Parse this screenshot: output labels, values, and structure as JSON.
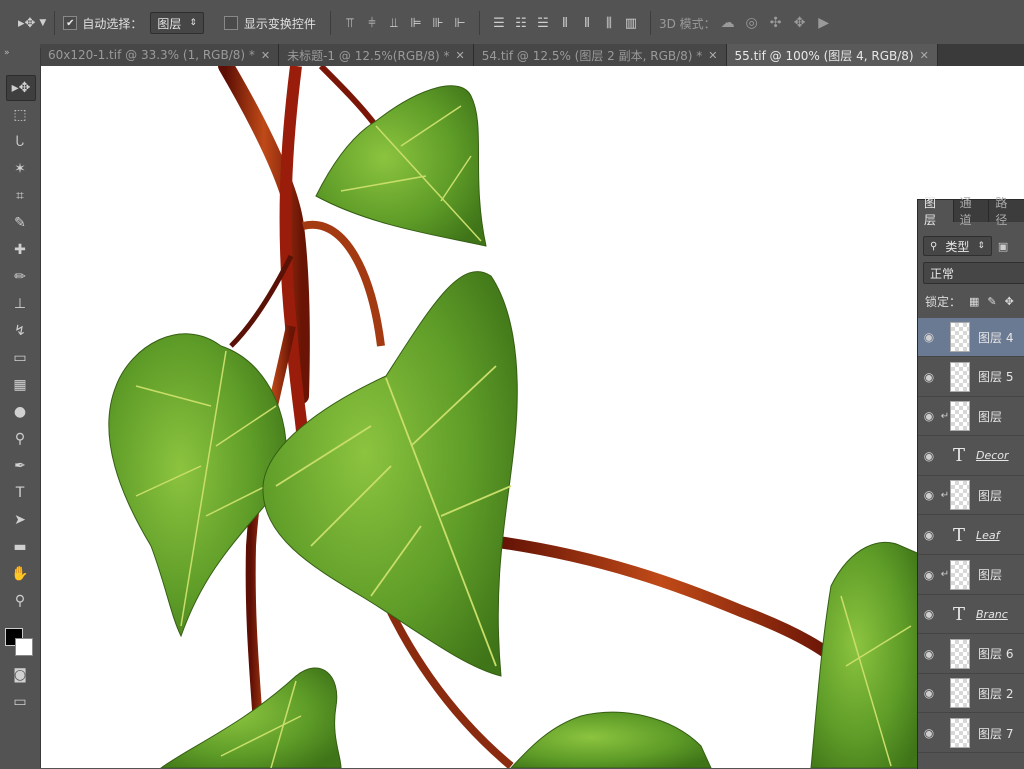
{
  "options_bar": {
    "auto_select_label": "自动选择：",
    "auto_select_value": "图层",
    "show_transform_label": "显示变换控件",
    "mode_3d_label": "3D 模式："
  },
  "document_tabs": [
    {
      "label": "60x120-1.tif @ 33.3% (1, RGB/8) *",
      "active": false
    },
    {
      "label": "未标题-1 @ 12.5%(RGB/8) *",
      "active": false
    },
    {
      "label": "54.tif @ 12.5% (图层 2 副本, RGB/8) *",
      "active": false
    },
    {
      "label": "55.tif @ 100% (图层 4, RGB/8)",
      "active": true
    }
  ],
  "tools": [
    {
      "name": "move-tool",
      "glyph": "▸✥"
    },
    {
      "name": "marquee-tool",
      "glyph": "⬚"
    },
    {
      "name": "lasso-tool",
      "glyph": "ᘂ"
    },
    {
      "name": "magic-wand-tool",
      "glyph": "✶"
    },
    {
      "name": "crop-tool",
      "glyph": "⌗"
    },
    {
      "name": "eyedropper-tool",
      "glyph": "✎"
    },
    {
      "name": "healing-brush-tool",
      "glyph": "✚"
    },
    {
      "name": "brush-tool",
      "glyph": "✏"
    },
    {
      "name": "clone-stamp-tool",
      "glyph": "⊥"
    },
    {
      "name": "history-brush-tool",
      "glyph": "↯"
    },
    {
      "name": "eraser-tool",
      "glyph": "▭"
    },
    {
      "name": "gradient-tool",
      "glyph": "▦"
    },
    {
      "name": "blur-tool",
      "glyph": "●"
    },
    {
      "name": "dodge-tool",
      "glyph": "⚲"
    },
    {
      "name": "pen-tool",
      "glyph": "✒"
    },
    {
      "name": "type-tool",
      "glyph": "T"
    },
    {
      "name": "path-selection-tool",
      "glyph": "➤"
    },
    {
      "name": "rectangle-tool",
      "glyph": "▬"
    },
    {
      "name": "hand-tool",
      "glyph": "✋"
    },
    {
      "name": "zoom-tool",
      "glyph": "⚲"
    }
  ],
  "layers_panel": {
    "tabs": [
      "图层",
      "通道",
      "路径"
    ],
    "filter_label": "类型",
    "blend_mode": "正常",
    "lock_label": "锁定：",
    "layers": [
      {
        "name": "图层 4",
        "kind": "pixel",
        "clipped": false,
        "selected": true
      },
      {
        "name": "图层 5",
        "kind": "pixel",
        "clipped": false,
        "selected": false
      },
      {
        "name": "图层",
        "kind": "pixel",
        "clipped": true,
        "selected": false
      },
      {
        "name": "Decor",
        "kind": "text",
        "clipped": false,
        "selected": false
      },
      {
        "name": "图层",
        "kind": "pixel",
        "clipped": true,
        "selected": false
      },
      {
        "name": "Leaf",
        "kind": "text",
        "clipped": false,
        "selected": false
      },
      {
        "name": "图层",
        "kind": "pixel",
        "clipped": true,
        "selected": false
      },
      {
        "name": "Branc",
        "kind": "text",
        "clipped": false,
        "selected": false
      },
      {
        "name": "图层 6",
        "kind": "pixel",
        "clipped": false,
        "selected": false
      },
      {
        "name": "图层 2",
        "kind": "pixel",
        "clipped": false,
        "selected": false
      },
      {
        "name": "图层 7",
        "kind": "pixel",
        "clipped": false,
        "selected": false
      }
    ]
  },
  "colors": {
    "leaf": "#5a9a2a",
    "leaf_light": "#86bd3f",
    "vein": "#c9de6a",
    "stem": "#8a1e0a",
    "stem_light": "#c4531a",
    "selection": "#6b7a93"
  }
}
